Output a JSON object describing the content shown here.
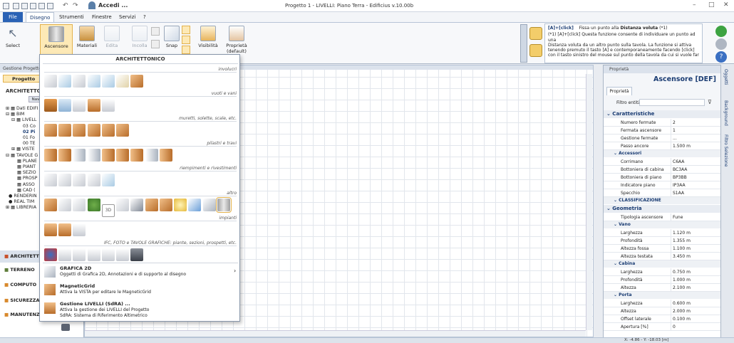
{
  "app": {
    "title": "Progetto 1 - LIVELLI: Piano Terra - Edificius v.10.00b",
    "account_label": "Accedi ..."
  },
  "menu": {
    "items": [
      "File",
      "Disegno",
      "Strumenti",
      "Finestre",
      "Servizi",
      "?"
    ],
    "active": "Disegno"
  },
  "ribbon": {
    "buttons": [
      {
        "label": "Select",
        "icon": "cursor-icon"
      },
      {
        "label": "Ascensore",
        "icon": "elevator-icon"
      },
      {
        "label": "Materiali",
        "icon": "paint-bucket-icon"
      },
      {
        "label": "Edita",
        "icon": "edit-icon"
      },
      {
        "label": "Incolla",
        "icon": "paste-icon"
      },
      {
        "label": "Snap",
        "icon": "snap-icon"
      },
      {
        "label": "Visibilità",
        "icon": "eye-icon"
      },
      {
        "label": "Proprietà",
        "sub": "(default)",
        "icon": "brush-icon"
      }
    ]
  },
  "help": {
    "heading_key": "[A]+[click]",
    "heading_text": "Fissa un punto alla",
    "heading_bold": "Distanza voluta",
    "heading_ref": "(*1)",
    "body_lines": [
      "(*1)  [A]+[click] Questa funzione consente di individuare un punto ad una",
      "Distanza voluta da un altro punto sulla tavola. La funzione si attiva",
      "tenendo premuto il tasto [A] e contemporaneamente facendo [click]",
      "con il tasto sinistro del mouse sul punto della tavola da cui si vuole far"
    ]
  },
  "left_panel": {
    "header": "Gestione Progetto",
    "tab": "Progetto",
    "section": "ARCHITETTONICO",
    "nav_button": "Nav",
    "tree": [
      "Dati EDIFI",
      "BIM",
      "LIVELL",
      "03 Co",
      "02 Pi",
      "01 Fo",
      "00 TE",
      "VISTE",
      "TAVOLE G",
      "PLANE",
      "PIANT",
      "SEZIO",
      "PROSP",
      "ASSO",
      "CAD (",
      "RENDERIN",
      "REAL TIM",
      "LIBRERIA"
    ],
    "modules": [
      "ARCHITETTO",
      "TERRENO",
      "COMPUTO",
      "SICUREZZA",
      "MANUTENZ"
    ]
  },
  "popup": {
    "title": "ARCHITETTONICO",
    "categories": [
      "involucri",
      "vuoti e vani",
      "muretti, solette, scale, etc.",
      "pilastri e travi",
      "riempimenti e rivestimenti",
      "altro",
      "impianti",
      "IFC, FOTO e TAVOLE GRAFICHE: piante, sezioni, prospetti, etc."
    ],
    "entries": [
      {
        "title": "GRAFICA 2D",
        "desc": "Oggetti di Grafica 2D, Annotazioni e di supporto al disegno",
        "arrow": "›"
      },
      {
        "title": "MagneticGrid",
        "desc": "Attiva la VISTA per editare le MagneticGrid",
        "arrow": ""
      },
      {
        "title": "Gestione LIVELLI (SdRA) ...",
        "desc": "Attiva la gestione dei LIVELLI del Progetto",
        "desc2": "SdRA: Sistema di Riferimento Altimetrico",
        "arrow": ""
      }
    ]
  },
  "properties": {
    "panel_title": "Proprietà",
    "object_title": "Ascensore [DEF]",
    "tab": "Proprietà",
    "filter_label": "Filtro entità",
    "sections": [
      {
        "title": "Caratteristiche",
        "rows": [
          {
            "k": "Numero fermate",
            "v": "2"
          },
          {
            "k": "Fermata ascensore",
            "v": "1"
          },
          {
            "k": "Gestione fermate",
            "v": "..."
          },
          {
            "k": "Passo ancore",
            "v": "1.500 m"
          }
        ]
      },
      {
        "title": "Accessori",
        "sub": true,
        "rows": [
          {
            "k": "Corrimano",
            "v": "C6AA"
          },
          {
            "k": "Bottoniera di cabina",
            "v": "BC3AA"
          },
          {
            "k": "Bottoniera di piano",
            "v": "BP3BB"
          },
          {
            "k": "Indicatore piano",
            "v": "IP3AA"
          },
          {
            "k": "Specchio",
            "v": "S1AA"
          }
        ]
      },
      {
        "title": "CLASSIFICAZIONE",
        "sub": true,
        "rows": []
      },
      {
        "title": "Geometria",
        "rows": [
          {
            "k": "Tipologia ascensore",
            "v": "Fune"
          }
        ]
      },
      {
        "title": "Vano",
        "sub": true,
        "rows": [
          {
            "k": "Larghezza",
            "v": "1.120 m"
          },
          {
            "k": "Profondità",
            "v": "1.355 m"
          },
          {
            "k": "Altezza fossa",
            "v": "1.100 m"
          },
          {
            "k": "Altezza testata",
            "v": "3.450 m"
          }
        ]
      },
      {
        "title": "Cabina",
        "sub": true,
        "rows": [
          {
            "k": "Larghezza",
            "v": "0.750 m"
          },
          {
            "k": "Profondità",
            "v": "1.000 m"
          },
          {
            "k": "Altezza",
            "v": "2.100 m"
          }
        ]
      },
      {
        "title": "Porta",
        "sub": true,
        "rows": [
          {
            "k": "Larghezza",
            "v": "0.600 m"
          },
          {
            "k": "Altezza",
            "v": "2.000 m"
          },
          {
            "k": "Offset laterale",
            "v": "0.100 m"
          },
          {
            "k": "Apertura [%]",
            "v": "0"
          }
        ]
      }
    ]
  },
  "side_tabs": [
    "Oggetti",
    "Background",
    "Filtro Selezione"
  ],
  "status": {
    "coords": "X: -4.86 - Y: -18.03 [m]"
  }
}
